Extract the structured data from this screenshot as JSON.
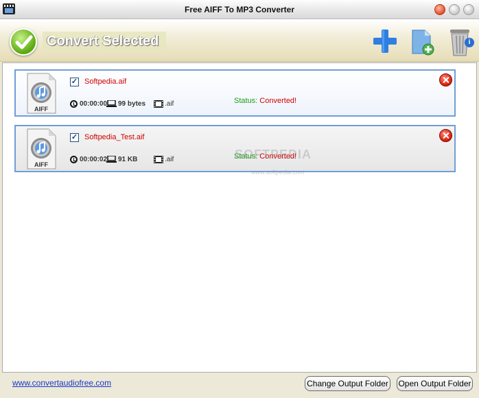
{
  "window": {
    "title": "Free AIFF To MP3 Converter"
  },
  "toolbar": {
    "convert_label": "Convert Selected",
    "icons": [
      "check-circle-icon",
      "add-file-icon",
      "add-folder-icon",
      "recycle-bin-icon",
      "info-icon"
    ],
    "info_glyph": "i"
  },
  "files": [
    {
      "name": "Softpedia.aif",
      "checked": true,
      "duration": "00:00:00",
      "size": "99 bytes",
      "ext": ".aif",
      "status_label": "Status: ",
      "status_value": "Converted!",
      "icon_label": "AIFF"
    },
    {
      "name": "Softpedia_Test.aif",
      "checked": true,
      "duration": "00:00:02",
      "size": "91 KB",
      "ext": ".aif",
      "status_label": "Status: ",
      "status_value": "Converted!",
      "icon_label": "AIFF"
    }
  ],
  "watermark": {
    "text": "SOFTPEDIA",
    "sub": "www.softpedia.com"
  },
  "bottom": {
    "link": "www.convertaudiofree.com",
    "change_folder": "Change Output Folder",
    "open_folder": "Open Output Folder"
  },
  "colors": {
    "status_ok": "#1a9e1a",
    "status_value": "#d00000",
    "file_name": "#d00000",
    "row_border": "#6f9ed6",
    "link": "#1a35c8"
  }
}
